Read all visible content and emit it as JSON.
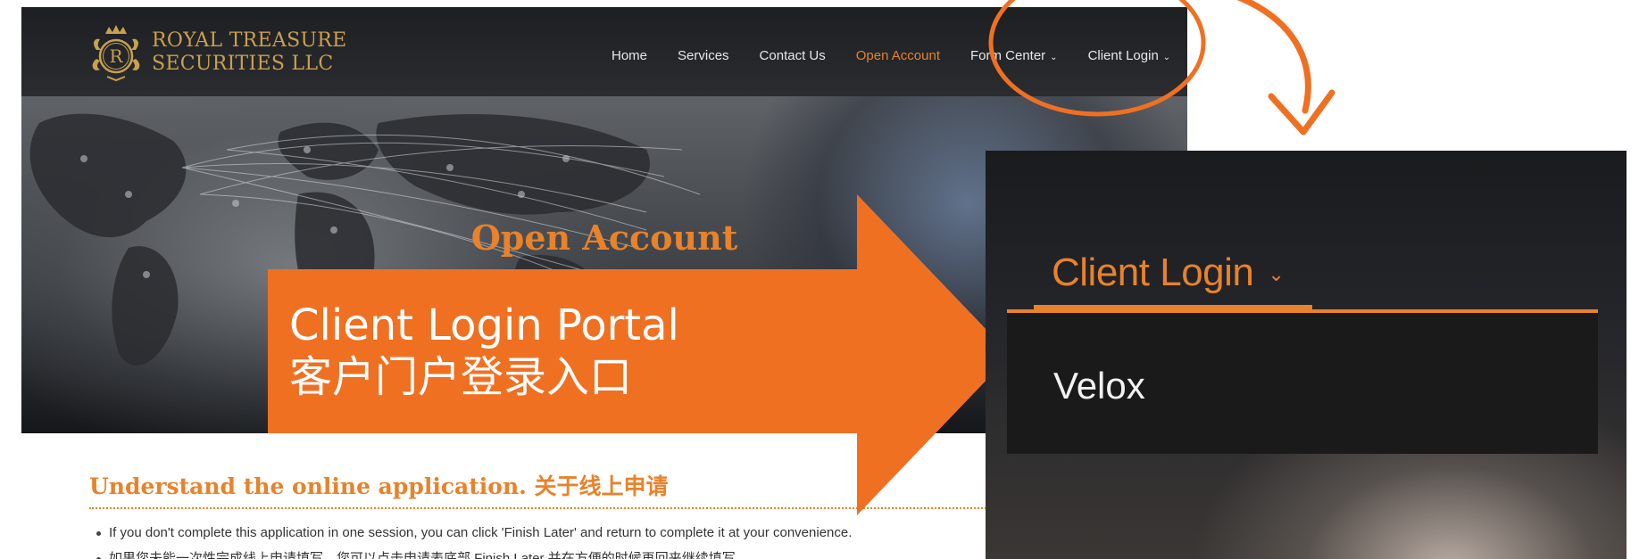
{
  "brand": {
    "line1": "ROYAL TREASURE",
    "line2": "SECURITIES LLC",
    "emblem_letter": "R",
    "gold": "#c9a04f"
  },
  "nav": {
    "items": [
      {
        "label": "Home",
        "active": false
      },
      {
        "label": "Services",
        "active": false
      },
      {
        "label": "Contact Us",
        "active": false
      },
      {
        "label": "Open Account",
        "active": true
      },
      {
        "label": "Form Center",
        "active": false,
        "dropdown": true
      },
      {
        "label": "Client Login",
        "active": false,
        "dropdown": true
      }
    ]
  },
  "hero": {
    "title": "Open Account"
  },
  "section": {
    "title": "Understand the online application. 关于线上申请",
    "bullets": [
      "If you don't complete this application in one session, you can click 'Finish Later' and return to complete it at your convenience.",
      "如果您未能一次性完成线上申请填写，您可以点击申请表底部 Finish Later 并在方便的时候再回来继续填写。"
    ]
  },
  "callout": {
    "line1": "Client Login Portal",
    "line2": "客户门户登录入口"
  },
  "inset": {
    "menu_label": "Client Login",
    "dropdown_items": [
      "Velox"
    ]
  },
  "colors": {
    "accent": "#e8822b",
    "callout_orange": "#f07022",
    "nav_bg": "#1d1f22",
    "dropdown_bg": "#1a1a1a"
  },
  "icons": {
    "nav_dropdown": "chevron-down-icon",
    "annotation_circle": "highlight-circle",
    "annotation_arrow": "curved-arrow-icon"
  }
}
